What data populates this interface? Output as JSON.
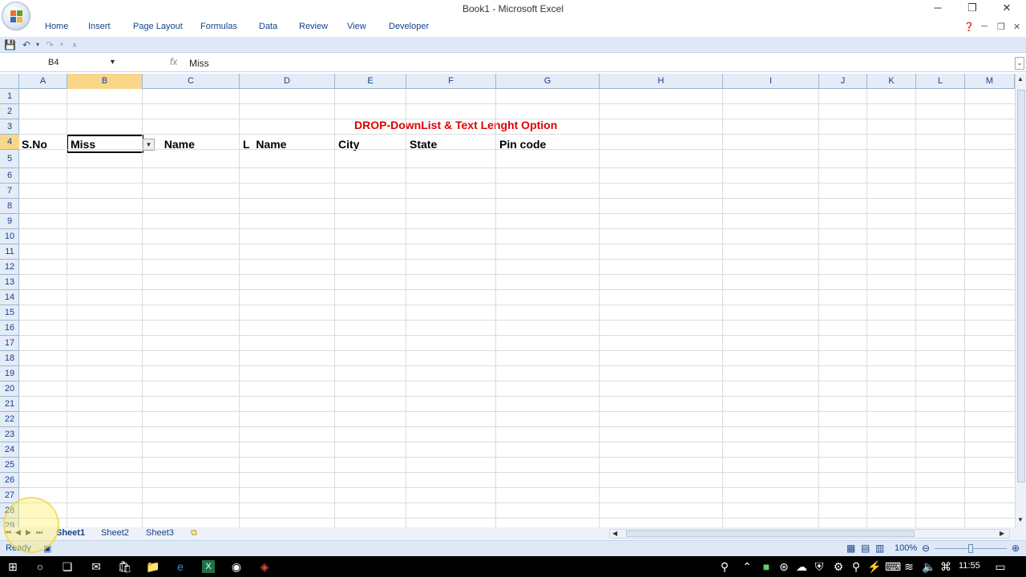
{
  "window": {
    "title": "Book1 - Microsoft Excel",
    "minimize": "─",
    "restore": "❐",
    "close": "✕"
  },
  "ribbon": {
    "tabs": [
      "Home",
      "Insert",
      "Page Layout",
      "Formulas",
      "Data",
      "Review",
      "View",
      "Developer"
    ]
  },
  "formula_bar": {
    "name_box": "B4",
    "fx_label": "fx",
    "value": "Miss"
  },
  "grid": {
    "columns": [
      "A",
      "B",
      "C",
      "D",
      "E",
      "F",
      "G",
      "H",
      "I",
      "J",
      "K",
      "L",
      "M"
    ],
    "rows": [
      "1",
      "2",
      "3",
      "4",
      "5",
      "6",
      "7",
      "8",
      "9",
      "10",
      "11",
      "12",
      "13",
      "14",
      "15",
      "16",
      "17",
      "18",
      "19",
      "20",
      "21",
      "22",
      "23",
      "24",
      "25",
      "26",
      "27",
      "28",
      "29"
    ],
    "selected_column": "B",
    "selected_row": "4",
    "title_text": "DROP-DownList & Text Lenght Option",
    "row4": {
      "a": "S.No",
      "b": "Miss",
      "c": "_Name",
      "d": "L_Name",
      "e": "City",
      "f": "State",
      "g": "Pin code"
    }
  },
  "sheets": {
    "tabs": [
      "Sheet1",
      "Sheet2",
      "Sheet3"
    ],
    "active": "Sheet1"
  },
  "status": {
    "text": "Ready",
    "zoom": "100%"
  },
  "taskbar": {
    "clock": "11:55"
  },
  "colors": {
    "title_red": "#e00000",
    "header_bg": "#e4ecf7",
    "selected_header": "#f8d68a"
  }
}
